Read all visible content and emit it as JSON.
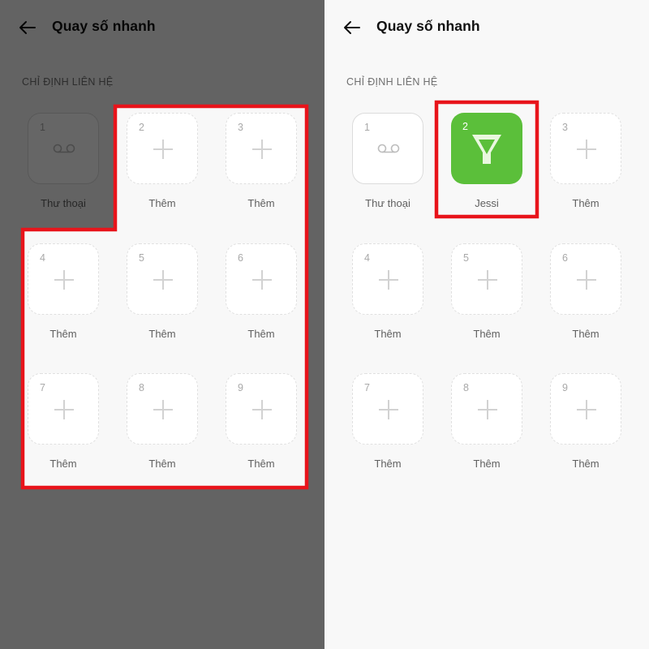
{
  "left_panel": {
    "header": {
      "title": "Quay số nhanh"
    },
    "section_label": "CHỈ ĐỊNH LIÊN HỆ",
    "tiles": [
      {
        "number": "1",
        "label": "Thư thoại"
      },
      {
        "number": "2",
        "label": "Thêm"
      },
      {
        "number": "3",
        "label": "Thêm"
      },
      {
        "number": "4",
        "label": "Thêm"
      },
      {
        "number": "5",
        "label": "Thêm"
      },
      {
        "number": "6",
        "label": "Thêm"
      },
      {
        "number": "7",
        "label": "Thêm"
      },
      {
        "number": "8",
        "label": "Thêm"
      },
      {
        "number": "9",
        "label": "Thêm"
      }
    ]
  },
  "right_panel": {
    "header": {
      "title": "Quay số nhanh"
    },
    "section_label": "CHỈ ĐỊNH LIÊN HỆ",
    "tiles": [
      {
        "number": "1",
        "label": "Thư thoại"
      },
      {
        "number": "2",
        "label": "Jessi"
      },
      {
        "number": "3",
        "label": "Thêm"
      },
      {
        "number": "4",
        "label": "Thêm"
      },
      {
        "number": "5",
        "label": "Thêm"
      },
      {
        "number": "6",
        "label": "Thêm"
      },
      {
        "number": "7",
        "label": "Thêm"
      },
      {
        "number": "8",
        "label": "Thêm"
      },
      {
        "number": "9",
        "label": "Thêm"
      }
    ]
  },
  "icons": {
    "back": "arrow-left-icon",
    "voicemail": "voicemail-icon",
    "add": "plus-icon",
    "contact_app": "funnel-contact-icon"
  },
  "colors": {
    "highlight": "#e8141b",
    "contact_tile": "#5bbf3a",
    "dim_overlay": "rgba(0,0,0,0.6)",
    "background": "#f8f8f8"
  }
}
